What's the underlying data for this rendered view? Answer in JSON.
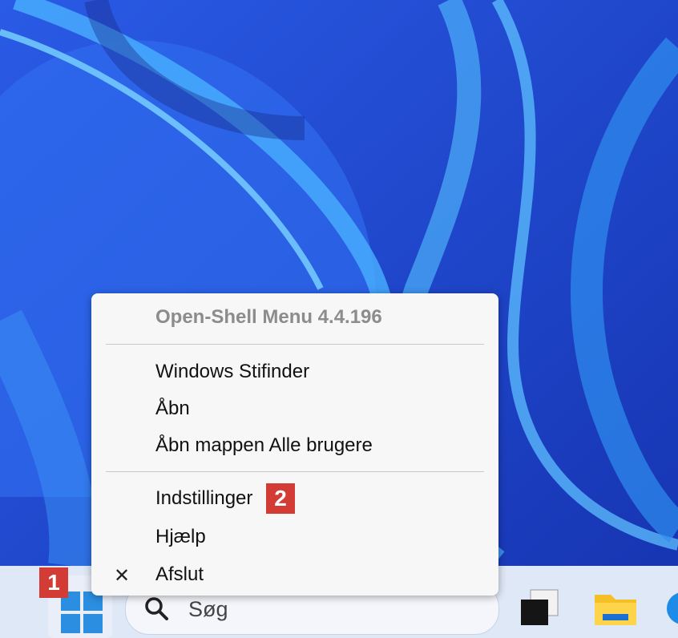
{
  "menu": {
    "title": "Open-Shell Menu 4.4.196",
    "items": [
      {
        "label": "Windows Stifinder"
      },
      {
        "label": "Åbn"
      },
      {
        "label": "Åbn mappen Alle brugere"
      },
      {
        "label": "Indstillinger"
      },
      {
        "label": "Hjælp"
      },
      {
        "label": "Afslut"
      }
    ],
    "check_glyph": "✕"
  },
  "taskbar": {
    "search_placeholder": "Søg",
    "icons": [
      "windows-logo-icon",
      "search-icon",
      "task-view-icon",
      "file-explorer-icon",
      "edge-icon"
    ]
  },
  "badges": {
    "start": "1",
    "settings": "2"
  },
  "colors": {
    "badge": "#d23c35",
    "wallpaper": "#1f3fc2",
    "taskbar": "#dfe8f6",
    "accent": "#2b8ee0"
  }
}
